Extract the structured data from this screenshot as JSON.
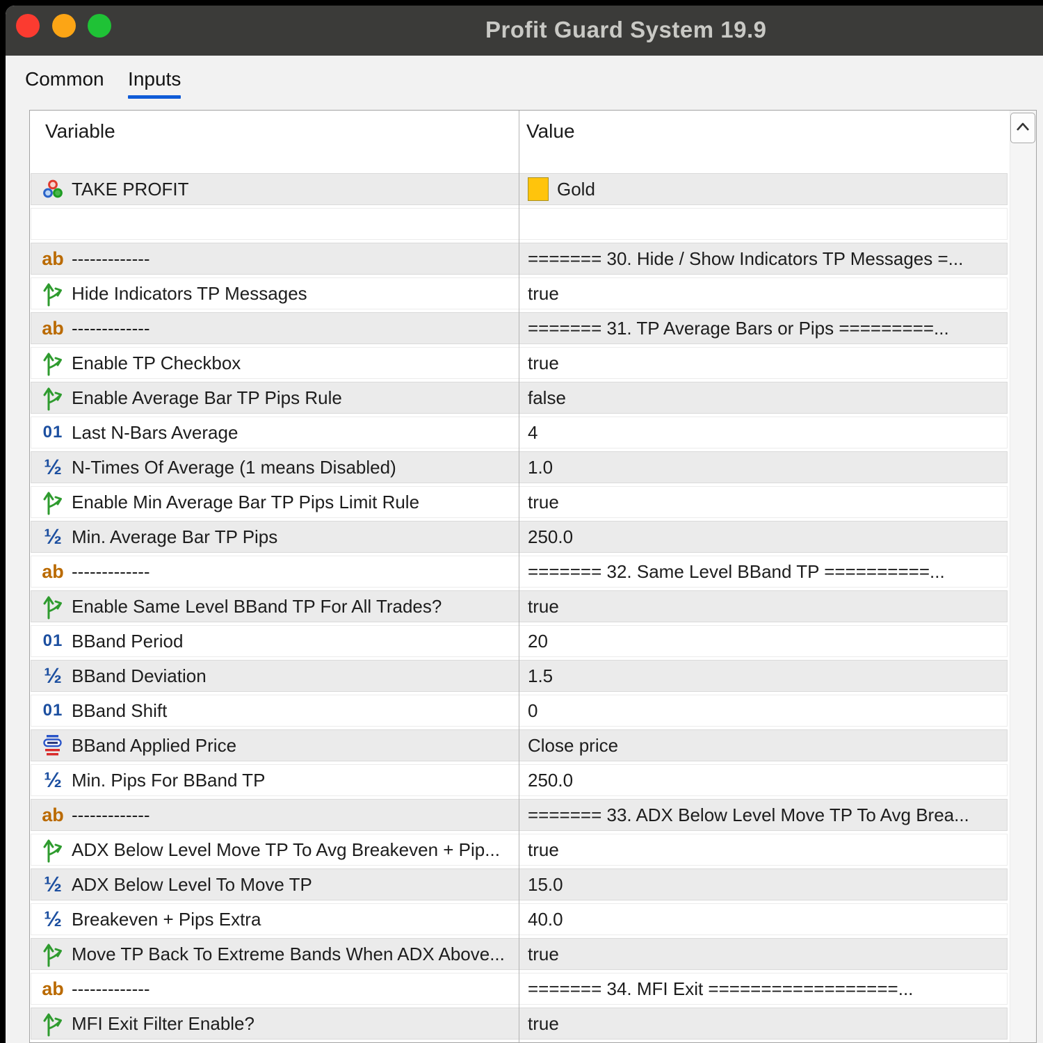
{
  "titlebar": {
    "title": "Profit Guard System 19.9",
    "traffic_lights": {
      "close": "#FB3B30",
      "minimize": "#FCA515",
      "zoom": "#1FC236"
    },
    "bg_color": "#3B3B39"
  },
  "tabs": [
    {
      "label": "Common",
      "active": false
    },
    {
      "label": "Inputs",
      "active": true
    }
  ],
  "colors": {
    "tab_underline_accent": "#0F5BD7",
    "row_shade": "#EBEBEB",
    "gold_swatch": "#FFC40C"
  },
  "table": {
    "columns": [
      "Variable",
      "Value"
    ],
    "scrollbar": {
      "up_icon": "chevron-up-icon"
    },
    "rows": [
      {
        "icon": "color-icon",
        "label": "TAKE PROFIT",
        "value": "Gold",
        "swatch": "#FFC40C",
        "shaded": true
      },
      {
        "icon": "",
        "label": "",
        "value": "",
        "shaded": false
      },
      {
        "icon": "ab-icon",
        "label": "-------------",
        "value": "======= 30. Hide / Show Indicators TP Messages =...",
        "shaded": true
      },
      {
        "icon": "bool-icon",
        "label": "Hide Indicators TP Messages",
        "value": "true",
        "shaded": false
      },
      {
        "icon": "ab-icon",
        "label": "-------------",
        "value": "======= 31. TP Average Bars or Pips =========...",
        "shaded": true
      },
      {
        "icon": "bool-icon",
        "label": "Enable TP Checkbox",
        "value": "true",
        "shaded": false
      },
      {
        "icon": "bool-icon",
        "label": "Enable Average Bar TP Pips Rule",
        "value": "false",
        "shaded": true
      },
      {
        "icon": "int-icon",
        "label": "Last N-Bars Average",
        "value": "4",
        "shaded": false
      },
      {
        "icon": "double-icon",
        "label": "N-Times Of Average (1 means Disabled)",
        "value": "1.0",
        "shaded": true
      },
      {
        "icon": "bool-icon",
        "label": "Enable Min Average Bar TP Pips Limit Rule",
        "value": "true",
        "shaded": false
      },
      {
        "icon": "double-icon",
        "label": "Min. Average Bar TP Pips",
        "value": "250.0",
        "shaded": true
      },
      {
        "icon": "ab-icon",
        "label": "-------------",
        "value": "======= 32. Same Level BBand TP ==========...",
        "shaded": false
      },
      {
        "icon": "bool-icon",
        "label": "Enable Same Level BBand TP For All Trades?",
        "value": "true",
        "shaded": true
      },
      {
        "icon": "int-icon",
        "label": "BBand Period",
        "value": "20",
        "shaded": false
      },
      {
        "icon": "double-icon",
        "label": "BBand Deviation",
        "value": "1.5",
        "shaded": true
      },
      {
        "icon": "int-icon",
        "label": "BBand Shift",
        "value": "0",
        "shaded": false
      },
      {
        "icon": "enum-icon",
        "label": "BBand Applied Price",
        "value": "Close price",
        "shaded": true
      },
      {
        "icon": "double-icon",
        "label": "Min. Pips For BBand TP",
        "value": "250.0",
        "shaded": false
      },
      {
        "icon": "ab-icon",
        "label": "-------------",
        "value": "======= 33. ADX Below Level Move TP To Avg Brea...",
        "shaded": true
      },
      {
        "icon": "bool-icon",
        "label": "ADX Below Level Move TP To Avg Breakeven + Pip...",
        "value": "true",
        "shaded": false
      },
      {
        "icon": "double-icon",
        "label": "ADX Below Level To Move TP",
        "value": "15.0",
        "shaded": true
      },
      {
        "icon": "double-icon",
        "label": "Breakeven + Pips Extra",
        "value": "40.0",
        "shaded": false
      },
      {
        "icon": "bool-icon",
        "label": "Move TP Back To Extreme Bands When ADX Above...",
        "value": "true",
        "shaded": true
      },
      {
        "icon": "ab-icon",
        "label": "-------------",
        "value": "======= 34. MFI Exit ==================...",
        "shaded": false
      },
      {
        "icon": "bool-icon",
        "label": "MFI Exit Filter Enable?",
        "value": "true",
        "shaded": true
      }
    ]
  }
}
